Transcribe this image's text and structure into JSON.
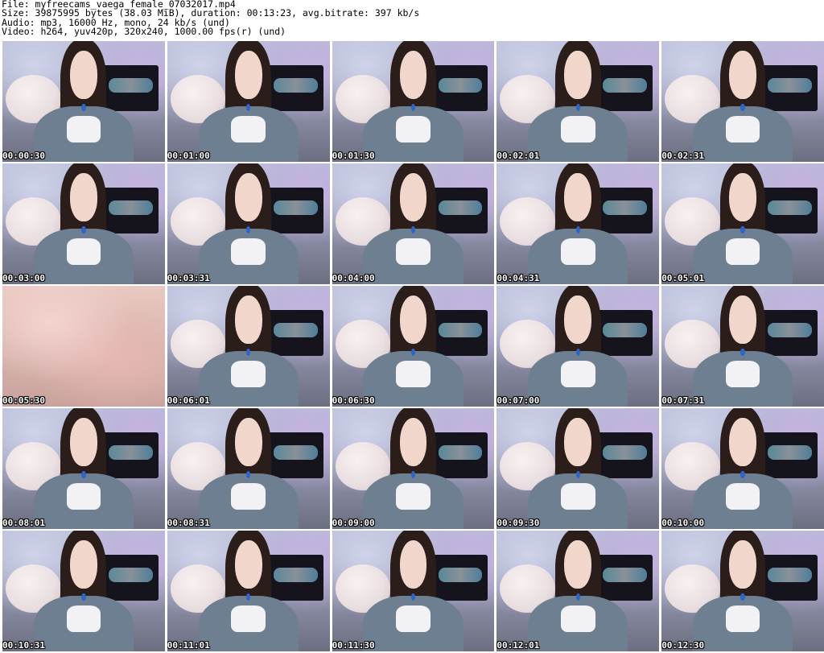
{
  "header": {
    "file": "File: myfreecams_vaega_female_07032017.mp4",
    "size": "Size: 39875995 bytes (38.03 MiB), duration: 00:13:23, avg.bitrate: 397 kb/s",
    "audio": "Audio: mp3, 16000 Hz, mono, 24 kb/s (und)",
    "video": "Video: h264, yuv420p, 320x240, 1000.00 fps(r) (und)"
  },
  "thumbnails": [
    {
      "timestamp": "00:00:30"
    },
    {
      "timestamp": "00:01:00"
    },
    {
      "timestamp": "00:01:30"
    },
    {
      "timestamp": "00:02:01"
    },
    {
      "timestamp": "00:02:31"
    },
    {
      "timestamp": "00:03:00"
    },
    {
      "timestamp": "00:03:31"
    },
    {
      "timestamp": "00:04:00"
    },
    {
      "timestamp": "00:04:31"
    },
    {
      "timestamp": "00:05:01"
    },
    {
      "timestamp": "00:05:30"
    },
    {
      "timestamp": "00:06:01"
    },
    {
      "timestamp": "00:06:30"
    },
    {
      "timestamp": "00:07:00"
    },
    {
      "timestamp": "00:07:31"
    },
    {
      "timestamp": "00:08:01"
    },
    {
      "timestamp": "00:08:31"
    },
    {
      "timestamp": "00:09:00"
    },
    {
      "timestamp": "00:09:30"
    },
    {
      "timestamp": "00:10:00"
    },
    {
      "timestamp": "00:10:31"
    },
    {
      "timestamp": "00:11:01"
    },
    {
      "timestamp": "00:11:30"
    },
    {
      "timestamp": "00:12:01"
    },
    {
      "timestamp": "00:12:30"
    }
  ]
}
